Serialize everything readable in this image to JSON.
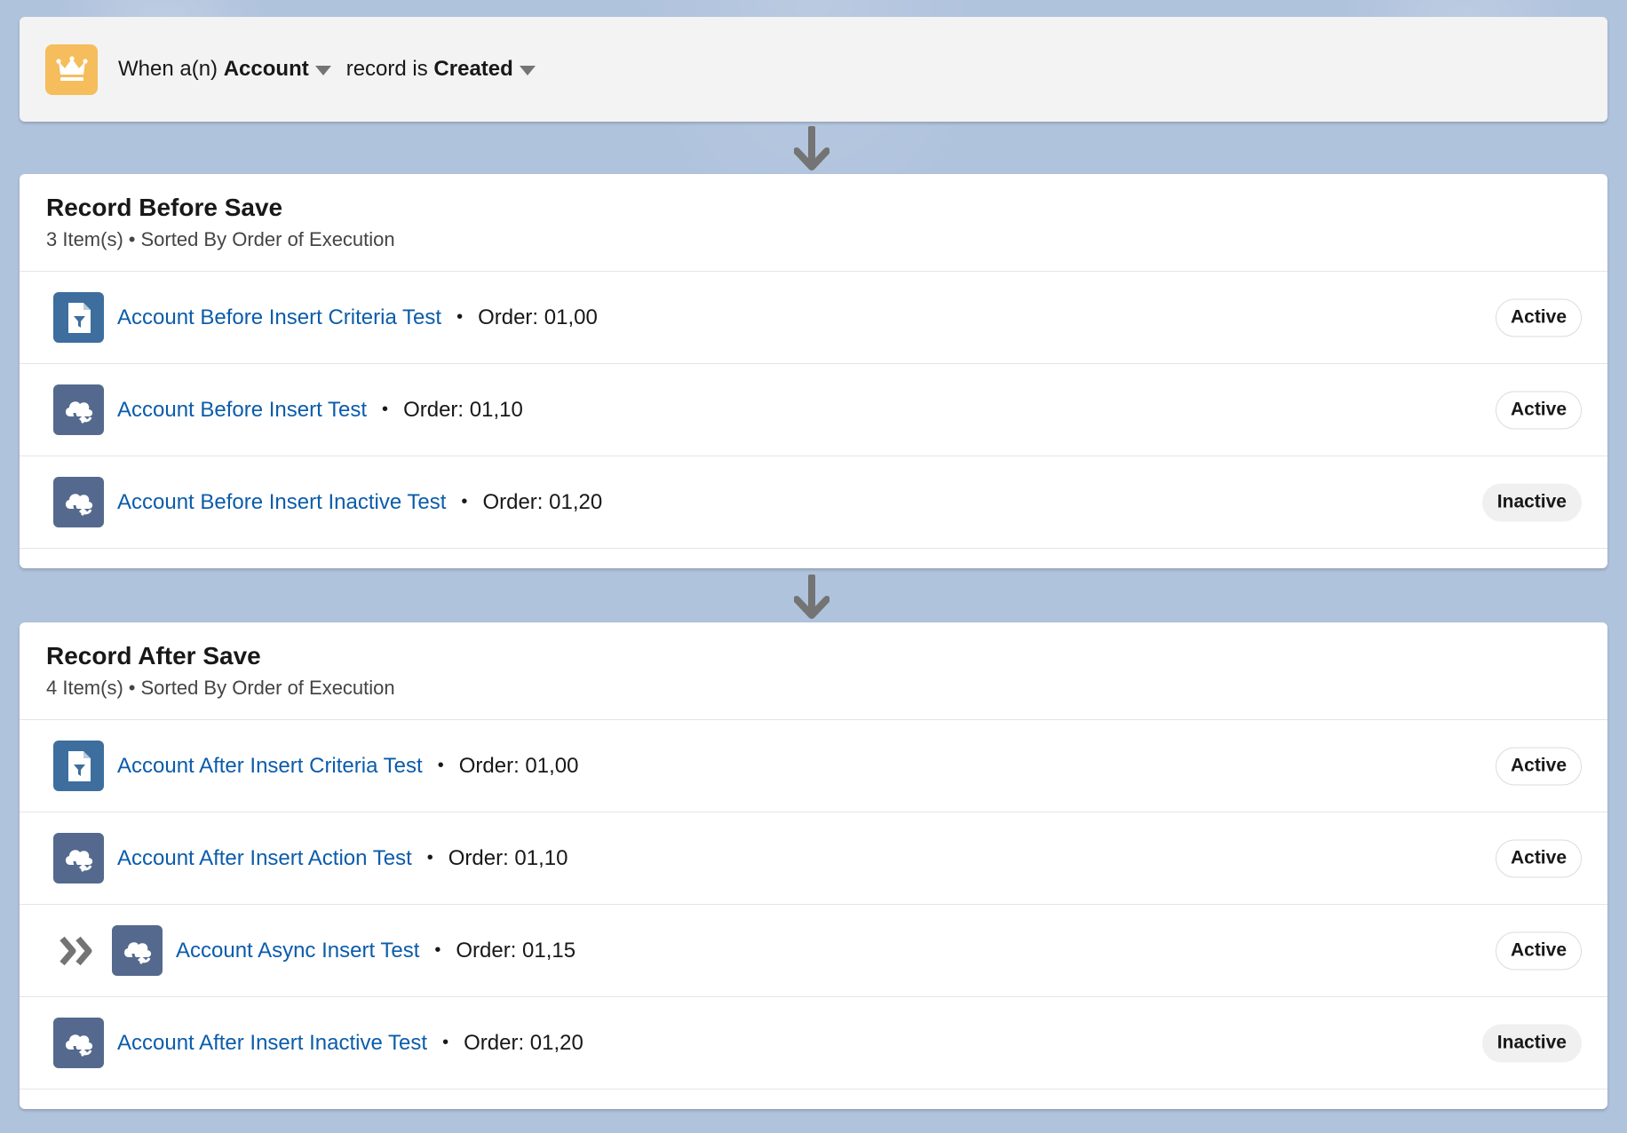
{
  "trigger": {
    "prefix": "When a(n)",
    "object": "Account",
    "middle": "record is",
    "event": "Created",
    "icon": "crown-icon",
    "icon_color": "#f5bd5c"
  },
  "sections": [
    {
      "title": "Record Before Save",
      "count": "3 Item(s)",
      "sort": "Sorted By Order of Execution",
      "items": [
        {
          "name": "Account Before Insert Criteria Test",
          "order": "Order: 01,00",
          "status": "Active",
          "icon": "flow-criteria-icon"
        },
        {
          "name": "Account Before Insert Test",
          "order": "Order: 01,10",
          "status": "Active",
          "icon": "flow-cloud-icon"
        },
        {
          "name": "Account Before Insert Inactive Test",
          "order": "Order: 01,20",
          "status": "Inactive",
          "icon": "flow-cloud-icon"
        }
      ]
    },
    {
      "title": "Record After Save",
      "count": "4 Item(s)",
      "sort": "Sorted By Order of Execution",
      "items": [
        {
          "name": "Account After Insert Criteria Test",
          "order": "Order: 01,00",
          "status": "Active",
          "icon": "flow-criteria-icon"
        },
        {
          "name": "Account After Insert Action Test",
          "order": "Order: 01,10",
          "status": "Active",
          "icon": "flow-cloud-icon"
        },
        {
          "name": "Account Async Insert Test",
          "order": "Order: 01,15",
          "status": "Active",
          "icon": "flow-cloud-icon",
          "async": true
        },
        {
          "name": "Account After Insert Inactive Test",
          "order": "Order: 01,20",
          "status": "Inactive",
          "icon": "flow-cloud-icon"
        }
      ]
    }
  ],
  "separator": "•",
  "colors": {
    "background": "#b0c3dd",
    "link": "#0b5cab",
    "criteria_icon_bg": "#3d6e9e",
    "cloud_icon_bg": "#54698d",
    "arrow": "#747474"
  }
}
